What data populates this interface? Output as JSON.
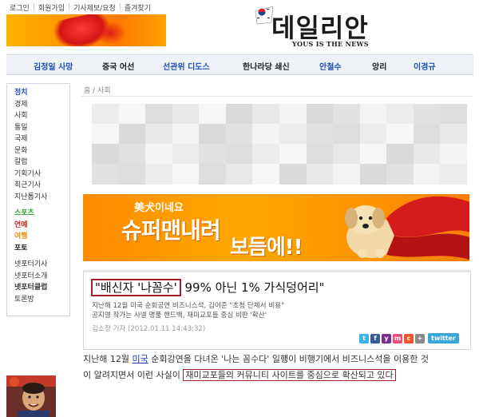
{
  "utility_links": [
    "로그인",
    "회원가입",
    "기사제보/요청",
    "즐겨찾기"
  ],
  "logo": {
    "title": "데일리안",
    "slogan": "YOUS IS THE NEWS"
  },
  "nav": [
    {
      "label": "김정일 사망",
      "color": "#1e50b4"
    },
    {
      "label": "중국 어선",
      "color": "#222222"
    },
    {
      "label": "선관위 디도스",
      "color": "#1e50b4"
    },
    {
      "label": "한나라당 쇄신",
      "color": "#222222"
    },
    {
      "label": "안철수",
      "color": "#1e50b4"
    },
    {
      "label": "앙리",
      "color": "#222222"
    },
    {
      "label": "이경규",
      "color": "#1e50b4"
    }
  ],
  "sidebar": {
    "group1": [
      {
        "label": "정치",
        "color": "#1e50b4",
        "bold": true
      },
      {
        "label": "경제"
      },
      {
        "label": "사회"
      },
      {
        "label": "통일"
      },
      {
        "label": "국제"
      },
      {
        "label": "문화"
      },
      {
        "label": "칼럼"
      },
      {
        "label": "기획기사"
      },
      {
        "label": "최근기사"
      },
      {
        "label": "지난톱기사"
      }
    ],
    "group2": [
      {
        "label": "스포츠",
        "color": "#2a9d2a",
        "bold": true
      },
      {
        "label": "연예",
        "color": "#d7241f",
        "bold": true
      },
      {
        "label": "여행",
        "color": "#ee8a00",
        "bold": true
      },
      {
        "label": "포토",
        "color": "#222222",
        "bold": true
      }
    ],
    "group3": [
      {
        "label": "넷포터기사"
      },
      {
        "label": "넷포터소개"
      },
      {
        "label": "넷포터클럽",
        "bold": true
      },
      {
        "label": "토론방"
      }
    ]
  },
  "breadcrumb": "홈 / 사회",
  "banner": {
    "line1": "美犬이네요",
    "line2": "슈퍼맨내려",
    "line3": "보듬에!!"
  },
  "article": {
    "headline_quoted": "\"배신자 '나꼼수'",
    "headline_rest": "99% 아닌 1% 가식덩어리\"",
    "subhead_line1": "지난해 12월 미국 순회공연 비즈니스석, 김어준 \"초청 단체서 비용\"",
    "subhead_line2": "공지영 작가는 사넬 명품 핸드백, 재미교포들 중심 비판 '확산'",
    "byline": "김소정 기자 (2012.01.11 14:43:32)",
    "share_label": "twitter"
  },
  "body": {
    "line1_a": "지난해 12월 ",
    "line1_link": "미국",
    "line1_b": " 순회강연을 다녀온 '나는 꼼수다' 일행이 비행기에서 비즈니스석을 이용한 것",
    "line2_a": "이 알려지면서 이런 사실이 ",
    "line2_boxed": "재미교포들의 커뮤니티 사이트를 중심으로 확산되고 있다"
  },
  "colors": {
    "accent_blue": "#1e50b4",
    "highlight_box": "#a3202a",
    "banner_orange": "#ff9a00"
  }
}
